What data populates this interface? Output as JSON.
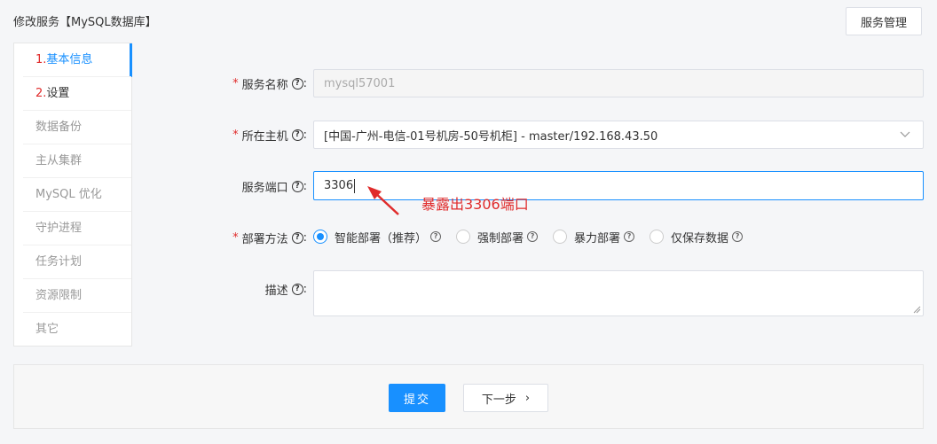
{
  "header": {
    "title": "修改服务【MySQL数据库】",
    "manage_button": "服务管理"
  },
  "sidebar": {
    "items": [
      {
        "num": "1.",
        "label": "基本信息"
      },
      {
        "num": "2.",
        "label": "设置"
      },
      {
        "num": "",
        "label": "数据备份"
      },
      {
        "num": "",
        "label": "主从集群"
      },
      {
        "num": "",
        "label": "MySQL 优化"
      },
      {
        "num": "",
        "label": "守护进程"
      },
      {
        "num": "",
        "label": "任务计划"
      },
      {
        "num": "",
        "label": "资源限制"
      },
      {
        "num": "",
        "label": "其它"
      }
    ]
  },
  "form": {
    "required_mark": "*",
    "help_glyph": "?",
    "service_name": {
      "label": "服务名称",
      "value": "mysql57001"
    },
    "host": {
      "label": "所在主机",
      "value": "[中国-广州-电信-01号机房-50号机柜] - master/192.168.43.50"
    },
    "port": {
      "label": "服务端口",
      "value": "3306"
    },
    "deploy": {
      "label": "部署方法",
      "options": [
        {
          "label": "智能部署（推荐）",
          "checked": true
        },
        {
          "label": "强制部署",
          "checked": false
        },
        {
          "label": "暴力部署",
          "checked": false
        },
        {
          "label": "仅保存数据",
          "checked": false
        }
      ]
    },
    "description": {
      "label": "描述",
      "value": ""
    },
    "colon": ":"
  },
  "annotation": {
    "text": "暴露出3306端口",
    "color": "#e02b2b"
  },
  "footer": {
    "submit": "提交",
    "next": "下一步",
    "next_arrow": "›"
  },
  "colors": {
    "accent": "#1890ff",
    "required": "#e02b2b"
  }
}
